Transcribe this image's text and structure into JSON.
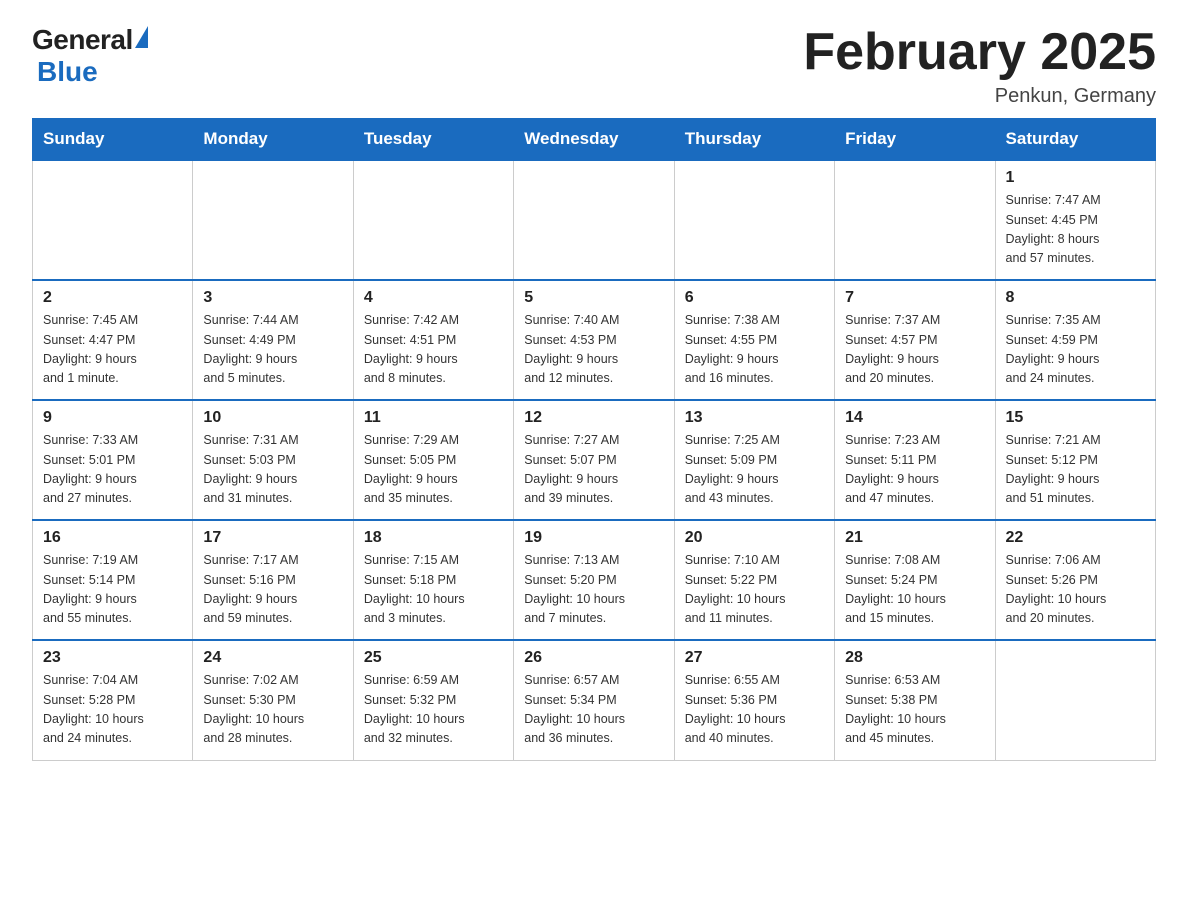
{
  "header": {
    "title": "February 2025",
    "location": "Penkun, Germany",
    "logo_general": "General",
    "logo_blue": "Blue"
  },
  "days_of_week": [
    "Sunday",
    "Monday",
    "Tuesday",
    "Wednesday",
    "Thursday",
    "Friday",
    "Saturday"
  ],
  "weeks": [
    {
      "days": [
        {
          "number": "",
          "info": ""
        },
        {
          "number": "",
          "info": ""
        },
        {
          "number": "",
          "info": ""
        },
        {
          "number": "",
          "info": ""
        },
        {
          "number": "",
          "info": ""
        },
        {
          "number": "",
          "info": ""
        },
        {
          "number": "1",
          "info": "Sunrise: 7:47 AM\nSunset: 4:45 PM\nDaylight: 8 hours\nand 57 minutes."
        }
      ]
    },
    {
      "days": [
        {
          "number": "2",
          "info": "Sunrise: 7:45 AM\nSunset: 4:47 PM\nDaylight: 9 hours\nand 1 minute."
        },
        {
          "number": "3",
          "info": "Sunrise: 7:44 AM\nSunset: 4:49 PM\nDaylight: 9 hours\nand 5 minutes."
        },
        {
          "number": "4",
          "info": "Sunrise: 7:42 AM\nSunset: 4:51 PM\nDaylight: 9 hours\nand 8 minutes."
        },
        {
          "number": "5",
          "info": "Sunrise: 7:40 AM\nSunset: 4:53 PM\nDaylight: 9 hours\nand 12 minutes."
        },
        {
          "number": "6",
          "info": "Sunrise: 7:38 AM\nSunset: 4:55 PM\nDaylight: 9 hours\nand 16 minutes."
        },
        {
          "number": "7",
          "info": "Sunrise: 7:37 AM\nSunset: 4:57 PM\nDaylight: 9 hours\nand 20 minutes."
        },
        {
          "number": "8",
          "info": "Sunrise: 7:35 AM\nSunset: 4:59 PM\nDaylight: 9 hours\nand 24 minutes."
        }
      ]
    },
    {
      "days": [
        {
          "number": "9",
          "info": "Sunrise: 7:33 AM\nSunset: 5:01 PM\nDaylight: 9 hours\nand 27 minutes."
        },
        {
          "number": "10",
          "info": "Sunrise: 7:31 AM\nSunset: 5:03 PM\nDaylight: 9 hours\nand 31 minutes."
        },
        {
          "number": "11",
          "info": "Sunrise: 7:29 AM\nSunset: 5:05 PM\nDaylight: 9 hours\nand 35 minutes."
        },
        {
          "number": "12",
          "info": "Sunrise: 7:27 AM\nSunset: 5:07 PM\nDaylight: 9 hours\nand 39 minutes."
        },
        {
          "number": "13",
          "info": "Sunrise: 7:25 AM\nSunset: 5:09 PM\nDaylight: 9 hours\nand 43 minutes."
        },
        {
          "number": "14",
          "info": "Sunrise: 7:23 AM\nSunset: 5:11 PM\nDaylight: 9 hours\nand 47 minutes."
        },
        {
          "number": "15",
          "info": "Sunrise: 7:21 AM\nSunset: 5:12 PM\nDaylight: 9 hours\nand 51 minutes."
        }
      ]
    },
    {
      "days": [
        {
          "number": "16",
          "info": "Sunrise: 7:19 AM\nSunset: 5:14 PM\nDaylight: 9 hours\nand 55 minutes."
        },
        {
          "number": "17",
          "info": "Sunrise: 7:17 AM\nSunset: 5:16 PM\nDaylight: 9 hours\nand 59 minutes."
        },
        {
          "number": "18",
          "info": "Sunrise: 7:15 AM\nSunset: 5:18 PM\nDaylight: 10 hours\nand 3 minutes."
        },
        {
          "number": "19",
          "info": "Sunrise: 7:13 AM\nSunset: 5:20 PM\nDaylight: 10 hours\nand 7 minutes."
        },
        {
          "number": "20",
          "info": "Sunrise: 7:10 AM\nSunset: 5:22 PM\nDaylight: 10 hours\nand 11 minutes."
        },
        {
          "number": "21",
          "info": "Sunrise: 7:08 AM\nSunset: 5:24 PM\nDaylight: 10 hours\nand 15 minutes."
        },
        {
          "number": "22",
          "info": "Sunrise: 7:06 AM\nSunset: 5:26 PM\nDaylight: 10 hours\nand 20 minutes."
        }
      ]
    },
    {
      "days": [
        {
          "number": "23",
          "info": "Sunrise: 7:04 AM\nSunset: 5:28 PM\nDaylight: 10 hours\nand 24 minutes."
        },
        {
          "number": "24",
          "info": "Sunrise: 7:02 AM\nSunset: 5:30 PM\nDaylight: 10 hours\nand 28 minutes."
        },
        {
          "number": "25",
          "info": "Sunrise: 6:59 AM\nSunset: 5:32 PM\nDaylight: 10 hours\nand 32 minutes."
        },
        {
          "number": "26",
          "info": "Sunrise: 6:57 AM\nSunset: 5:34 PM\nDaylight: 10 hours\nand 36 minutes."
        },
        {
          "number": "27",
          "info": "Sunrise: 6:55 AM\nSunset: 5:36 PM\nDaylight: 10 hours\nand 40 minutes."
        },
        {
          "number": "28",
          "info": "Sunrise: 6:53 AM\nSunset: 5:38 PM\nDaylight: 10 hours\nand 45 minutes."
        },
        {
          "number": "",
          "info": ""
        }
      ]
    }
  ]
}
